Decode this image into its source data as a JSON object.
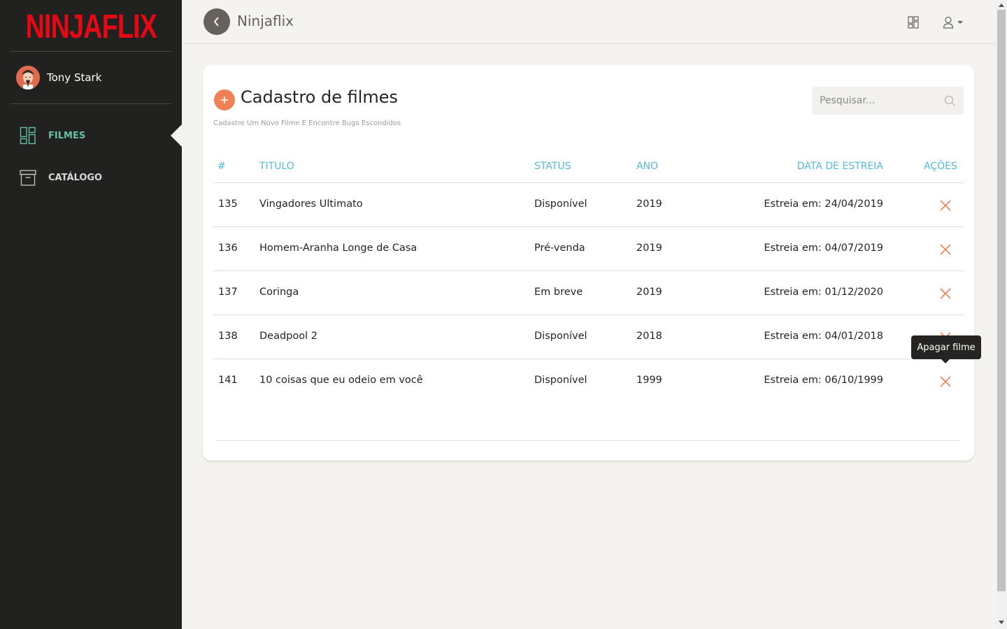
{
  "app": {
    "logo": "NINJAFLIX",
    "title": "Ninjaflix"
  },
  "user": {
    "name": "Tony Stark"
  },
  "sidebar": {
    "items": [
      {
        "label": "FILMES",
        "icon": "dashboard-icon",
        "active": true
      },
      {
        "label": "CATÁLOGO",
        "icon": "archive-icon",
        "active": false
      }
    ]
  },
  "card": {
    "title": "Cadastro de filmes",
    "subtitle": "Cadastre Um Novo Filme E Encontre Bugs Escondidos",
    "search_placeholder": "Pesquisar..."
  },
  "table": {
    "headers": {
      "id": "#",
      "title": "TITULO",
      "status": "STATUS",
      "year": "ANO",
      "release": "DATA DE ESTREIA",
      "actions": "AÇÕES"
    },
    "rows": [
      {
        "id": "135",
        "title": "Vingadores Ultimato",
        "status": "Disponível",
        "year": "2019",
        "release": "Estreia em: 24/04/2019"
      },
      {
        "id": "136",
        "title": "Homem-Aranha Longe de Casa",
        "status": "Pré-venda",
        "year": "2019",
        "release": "Estreia em: 04/07/2019"
      },
      {
        "id": "137",
        "title": "Coringa",
        "status": "Em breve",
        "year": "2019",
        "release": "Estreia em: 01/12/2020"
      },
      {
        "id": "138",
        "title": "Deadpool 2",
        "status": "Disponível",
        "year": "2018",
        "release": "Estreia em: 04/01/2018"
      },
      {
        "id": "141",
        "title": "10 coisas que eu odeio em você",
        "status": "Disponível",
        "year": "1999",
        "release": "Estreia em: 06/10/1999"
      }
    ]
  },
  "tooltip": {
    "text": "Apagar filme"
  },
  "colors": {
    "sidebar_bg": "#212120",
    "logo_red": "#e50914",
    "active_nav": "#66c1a8",
    "header_cyan": "#51bcda",
    "delete_orange": "#ef8157",
    "page_bg": "#f4f3ef"
  }
}
